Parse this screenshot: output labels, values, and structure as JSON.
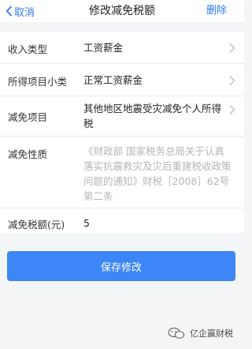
{
  "header": {
    "back_label": "取消",
    "title": "修改减免税额",
    "delete_label": "删除"
  },
  "form": {
    "rows": [
      {
        "label": "收入类型",
        "value": "工资薪金"
      },
      {
        "label": "所得项目小类",
        "value": "正常工资薪金"
      },
      {
        "label": "减免项目",
        "value": "其他地区地震受灾减免个人所得税"
      },
      {
        "label": "减免性质",
        "value": "《财政部 国家税务总局关于认真落实抗震救灾及灾后重建税收政策问题的通知》财税［2008］62号第二条"
      },
      {
        "label": "减免税额(元)",
        "value": "5"
      }
    ]
  },
  "actions": {
    "save_label": "保存修改"
  },
  "watermark": {
    "text": "亿企赢财税"
  },
  "colors": {
    "accent": "#2f7bf1",
    "button": "#3c86f7",
    "background": "#f4f5f7"
  }
}
